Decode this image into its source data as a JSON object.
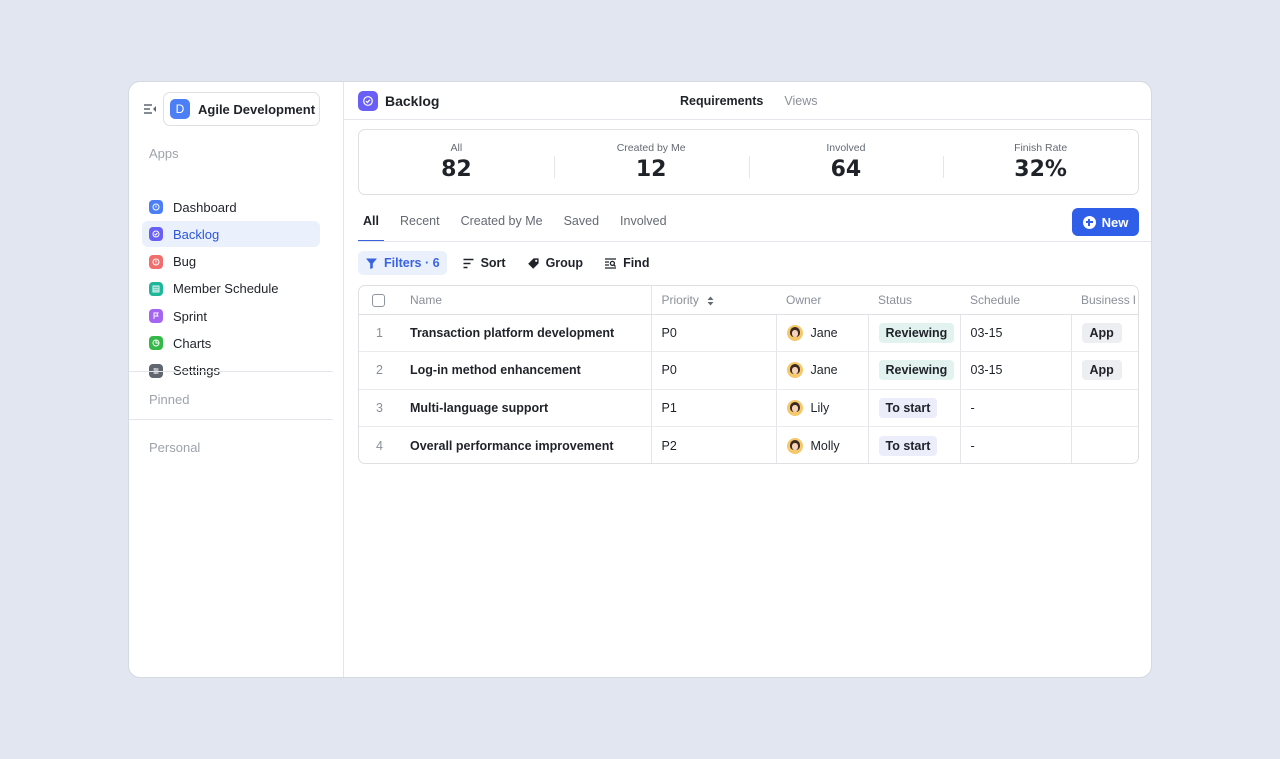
{
  "workspace": {
    "initial": "D",
    "name": "Agile Development"
  },
  "sidebar": {
    "apps_label": "Apps",
    "items": [
      {
        "label": "Dashboard",
        "icon": "dashboard-icon",
        "color": "#4c7ef5"
      },
      {
        "label": "Backlog",
        "icon": "backlog-icon",
        "color": "#6a5ff5"
      },
      {
        "label": "Bug",
        "icon": "bug-icon",
        "color": "#f06e6e"
      },
      {
        "label": "Member Schedule",
        "icon": "schedule-icon",
        "color": "#1fb69a"
      },
      {
        "label": "Sprint",
        "icon": "sprint-icon",
        "color": "#a565f0"
      },
      {
        "label": "Charts",
        "icon": "charts-icon",
        "color": "#34b949"
      },
      {
        "label": "Settings",
        "icon": "settings-icon",
        "color": "#5f6670"
      }
    ],
    "pinned_label": "Pinned",
    "personal_label": "Personal"
  },
  "header": {
    "title": "Backlog",
    "tabs": [
      "Requirements",
      "Views"
    ]
  },
  "stats": [
    {
      "label": "All",
      "value": "82"
    },
    {
      "label": "Created by Me",
      "value": "12"
    },
    {
      "label": "Involved",
      "value": "64"
    },
    {
      "label": "Finish Rate",
      "value": "32%"
    }
  ],
  "view_tabs": [
    "All",
    "Recent",
    "Created by Me",
    "Saved",
    "Involved"
  ],
  "new_button": "New",
  "toolbar": {
    "filters": "Filters · 6",
    "sort": "Sort",
    "group": "Group",
    "find": "Find"
  },
  "table": {
    "columns": [
      "Name",
      "Priority",
      "Owner",
      "Status",
      "Schedule",
      "Business l"
    ],
    "rows": [
      {
        "num": "1",
        "name": "Transaction platform development",
        "priority": "P0",
        "owner": "Jane",
        "status": "Reviewing",
        "schedule": "03-15",
        "business": "App"
      },
      {
        "num": "2",
        "name": "Log-in method enhancement",
        "priority": "P0",
        "owner": "Jane",
        "status": "Reviewing",
        "schedule": "03-15",
        "business": "App"
      },
      {
        "num": "3",
        "name": "Multi-language support",
        "priority": "P1",
        "owner": "Lily",
        "status": "To start",
        "schedule": "-",
        "business": ""
      },
      {
        "num": "4",
        "name": "Overall performance improvement",
        "priority": "P2",
        "owner": "Molly",
        "status": "To start",
        "schedule": "-",
        "business": ""
      }
    ]
  },
  "colors": {
    "accent": "#2f5ee8",
    "active_bg": "#ebf0fd"
  }
}
